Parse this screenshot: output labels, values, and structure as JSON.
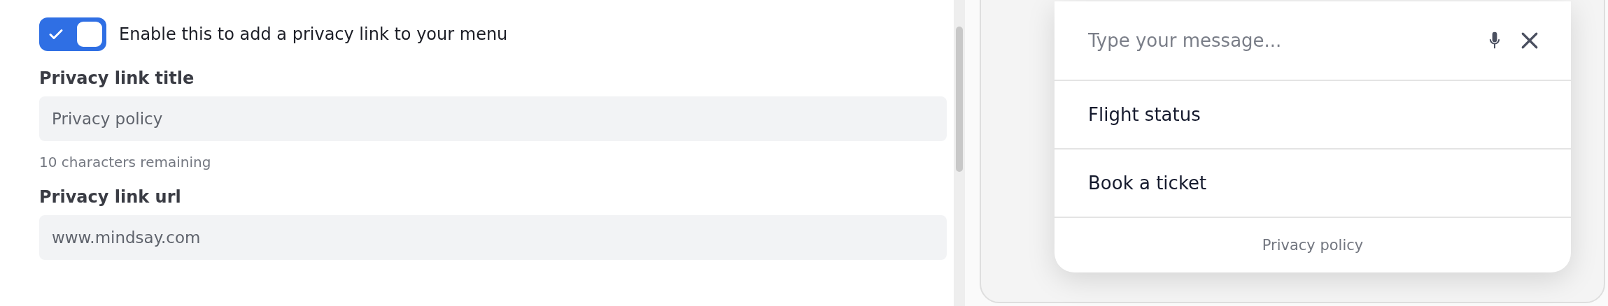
{
  "privacy_toggle": {
    "label": "Enable this to add a privacy link to your menu",
    "on": true
  },
  "fields": [
    {
      "label": "Privacy link title",
      "value": "Privacy policy",
      "helper": "10 characters remaining"
    },
    {
      "label": "Privacy link url",
      "value": "www.mindsay.com"
    }
  ],
  "preview": {
    "message_input": {
      "placeholder": "Type your message..."
    },
    "menu_items": [
      {
        "label": "Flight status"
      },
      {
        "label": "Book a ticket"
      }
    ],
    "privacy_link": "Privacy policy"
  }
}
